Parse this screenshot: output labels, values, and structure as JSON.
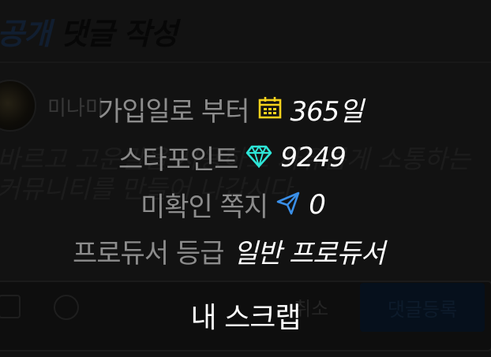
{
  "background": {
    "title_accent": "공개",
    "title_rest": "댓글 작성",
    "user_name": "미나미",
    "placeholder": "바르고 고운말을 사용하고 자유롭게 소통하는 커뮤니티를 만들어 나갑시다",
    "cancel_label": "취소",
    "submit_label": "댓글등록"
  },
  "menu": {
    "join_label": "가입일로 부터",
    "join_icon": "calendar-icon",
    "join_value": "365일",
    "points_label": "스타포인트",
    "points_icon": "diamond-icon",
    "points_value": "9249",
    "messages_label": "미확인 쪽지",
    "messages_icon": "paper-plane-icon",
    "messages_value": "0",
    "grade_label": "프로듀서 등급",
    "grade_value": "일반 프로듀서",
    "scrap_label": "내 스크랩"
  },
  "colors": {
    "calendar": "#f5d21c",
    "diamond": "#2ee6d8",
    "plane": "#3a8fe8",
    "title_accent": "#1b2f4a"
  }
}
